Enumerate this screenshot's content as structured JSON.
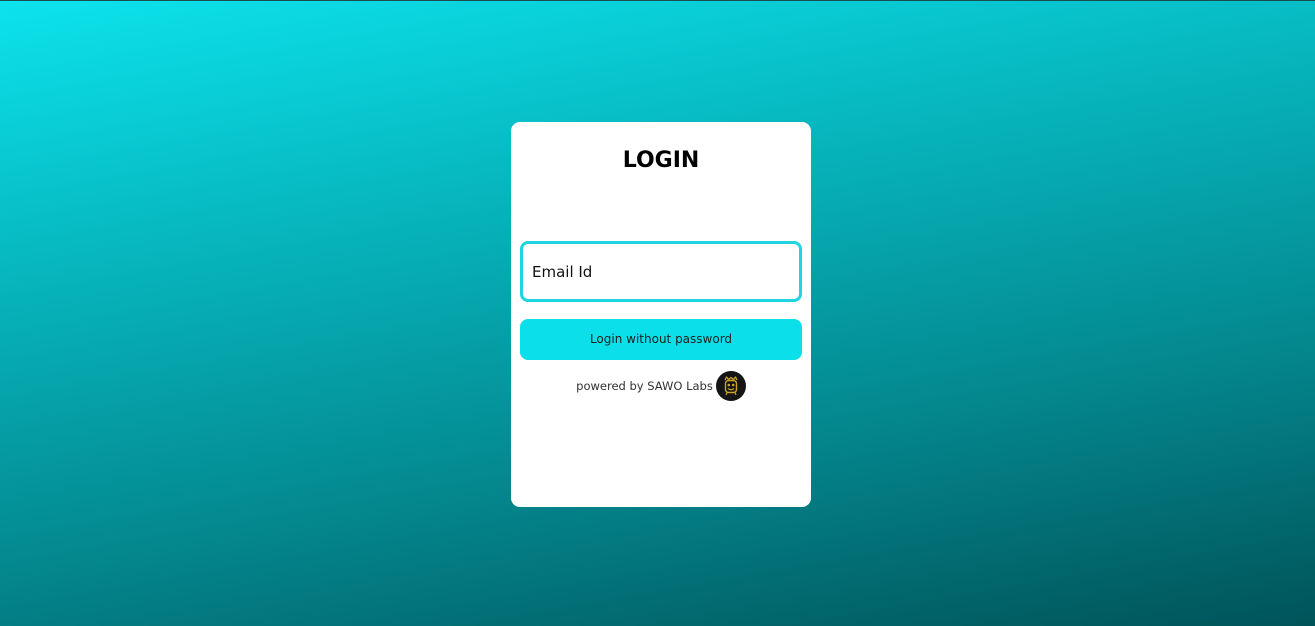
{
  "login": {
    "title": "LOGIN",
    "email_placeholder": "Email Id",
    "email_value": "",
    "submit_label": "Login without password",
    "powered_by": "powered by SAWO Labs",
    "logo_icon": "sawo-labs-logo-icon"
  },
  "colors": {
    "accent": "#0be0ea",
    "input_border": "#1fd5e1",
    "background_top": "#0ce3ec",
    "background_bottom": "#005459",
    "card": "#ffffff"
  }
}
